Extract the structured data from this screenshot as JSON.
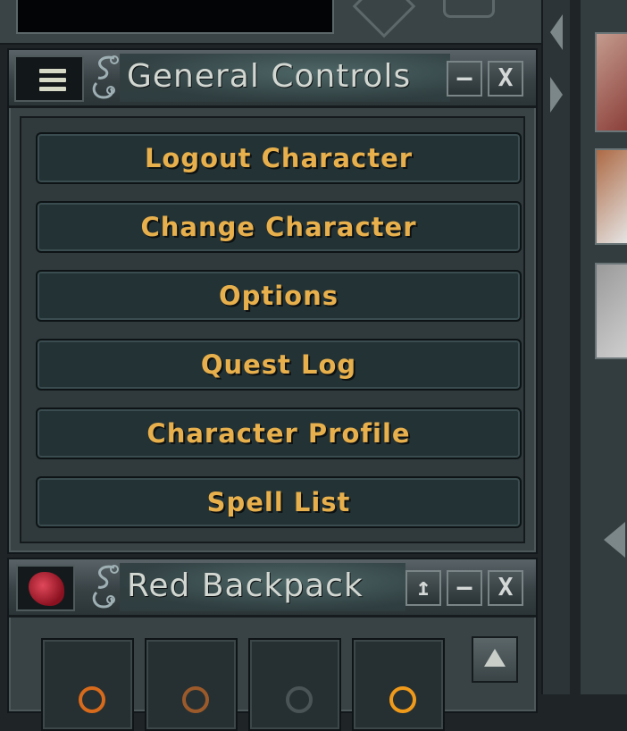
{
  "general_controls": {
    "title": "General Controls",
    "minimize_label": "–",
    "close_label": "X",
    "buttons": [
      {
        "label": "Logout Character"
      },
      {
        "label": "Change Character"
      },
      {
        "label": "Options"
      },
      {
        "label": "Quest Log"
      },
      {
        "label": "Character Profile"
      },
      {
        "label": "Spell List"
      }
    ]
  },
  "backpack": {
    "title": "Red Backpack",
    "up_label": "↥",
    "minimize_label": "–",
    "close_label": "X"
  },
  "colors": {
    "button_text": "#e8b04c",
    "panel": "#394346",
    "button_bg": "#233235"
  },
  "icons": {
    "menu": "hamburger-icon",
    "ornament": "scroll-ornament-icon",
    "backpack": "red-backpack-icon"
  }
}
